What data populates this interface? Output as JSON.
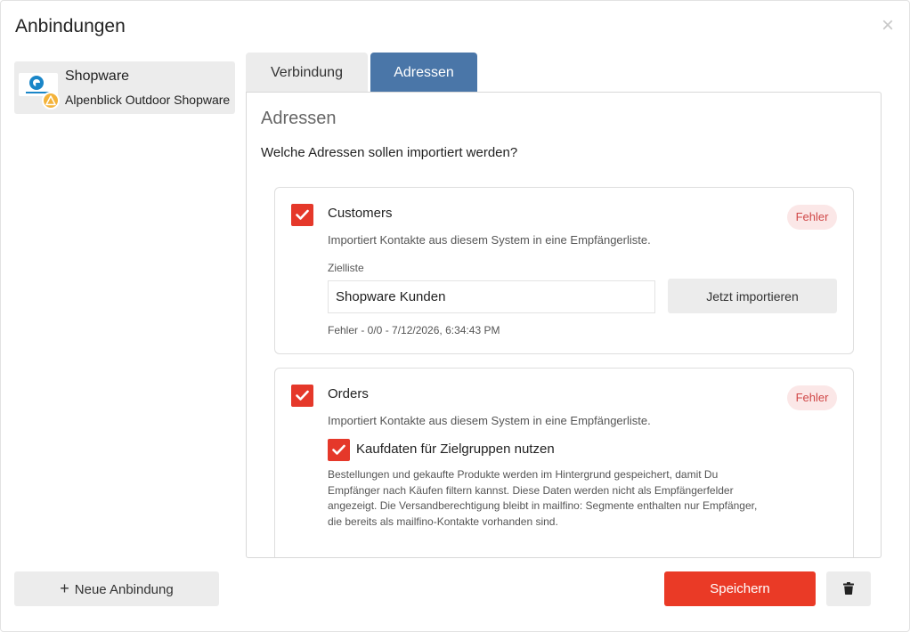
{
  "dialog": {
    "title": "Anbindungen",
    "close_icon": "close-icon"
  },
  "sidebar": {
    "connection": {
      "name": "Shopware",
      "subtitle": "Alpenblick Outdoor Shopware",
      "logo_icon": "shopware-logo",
      "status_icon": "warning-icon",
      "status_color": "#f4b33a"
    }
  },
  "tabs": [
    {
      "label": "Verbindung",
      "active": false
    },
    {
      "label": "Adressen",
      "active": true
    }
  ],
  "panel": {
    "title": "Adressen",
    "question": "Welche Adressen sollen importiert werden?",
    "cards": [
      {
        "name": "Customers",
        "checked": true,
        "description": "Importiert Kontakte aus diesem System in eine Empfängerliste.",
        "badge": "Fehler",
        "zielliste_label": "Zielliste",
        "zielliste_value": "Shopware Kunden",
        "import_label": "Jetzt importieren",
        "status": "Fehler - 0/0 - 7/12/2026, 6:34:43 PM"
      },
      {
        "name": "Orders",
        "checked": true,
        "description": "Importiert Kontakte aus diesem System in eine Empfängerliste.",
        "badge": "Fehler",
        "option_label": "Kaufdaten für Zielgruppen nutzen",
        "option_checked": true,
        "note": "Bestellungen und gekaufte Produkte werden im Hintergrund gespeichert, damit Du Empfänger nach Käufen filtern kannst. Diese Daten werden nicht als Empfängerfelder angezeigt. Die Versandberechtigung bleibt in mailfino: Segmente enthalten nur Empfänger, die bereits als mailfino-Kontakte vorhanden sind."
      }
    ]
  },
  "footer": {
    "new_label": "Neue Anbindung",
    "save_label": "Speichern",
    "delete_icon": "trash-icon"
  },
  "colors": {
    "accent": "#ea3a26",
    "tab_active": "#4a76a8",
    "badge_bg": "#fbe7e7",
    "badge_text": "#d04848"
  }
}
